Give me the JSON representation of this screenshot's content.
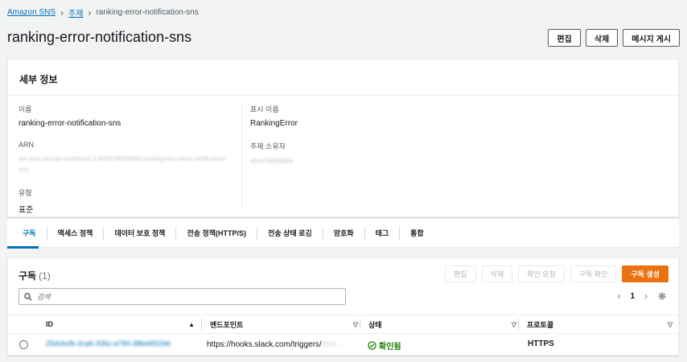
{
  "breadcrumb": {
    "root": "Amazon SNS",
    "section": "주제",
    "current": "ranking-error-notification-sns"
  },
  "header": {
    "title": "ranking-error-notification-sns",
    "edit": "편집",
    "delete": "삭제",
    "publish": "메시지 게시"
  },
  "details": {
    "heading": "세부 정보",
    "name_label": "이름",
    "name_value": "ranking-error-notification-sns",
    "arn_label": "ARN",
    "arn_value": "arn:aws:sns:ap-northeast-2:404476855864:ranking-dev-error-notification-sns",
    "type_label": "유형",
    "type_value": "표준",
    "display_label": "표시 이름",
    "display_value": "RankingError",
    "owner_label": "주제 소유자",
    "owner_value": "404476855864"
  },
  "tabs": [
    "구독",
    "액세스 정책",
    "데이터 보호 정책",
    "전송 정책(HTTP/S)",
    "전송 상태 로깅",
    "암호화",
    "태그",
    "통합"
  ],
  "subscriptions": {
    "title": "구독",
    "count": "(1)",
    "buttons": {
      "edit": "편집",
      "delete": "삭제",
      "request_confirm": "확인 요청",
      "confirm": "구독 확인",
      "create": "구독 생성"
    },
    "search_placeholder": "검색",
    "page": "1",
    "columns": {
      "id": "ID",
      "endpoint": "엔드포인트",
      "status": "상태",
      "protocol": "프로토콜"
    },
    "rows": [
      {
        "id": "25dcbcfb-2ca6-436c-a790-38bd4f22de",
        "endpoint": "https://hooks.slack.com/triggers/",
        "endpoint_blur": "XXX...",
        "status": "확인됨",
        "protocol": "HTTPS"
      }
    ]
  },
  "colors": {
    "link": "#0073bb",
    "primary": "#ec7211",
    "success": "#1d8102"
  }
}
